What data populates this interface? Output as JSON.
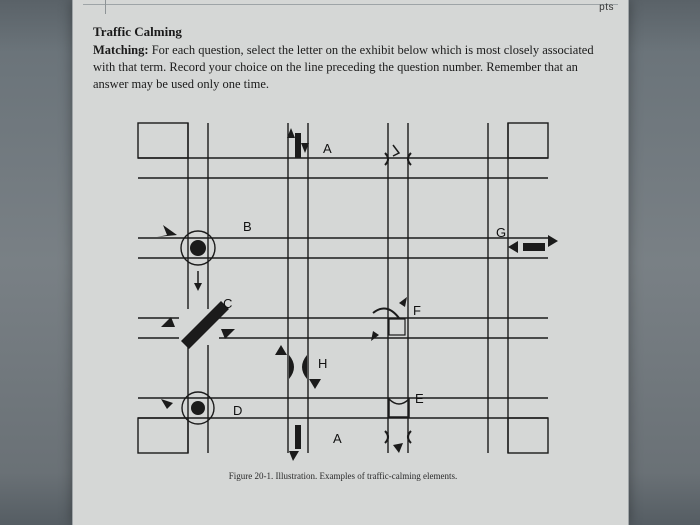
{
  "header_fragment": "pts",
  "title": "Traffic Calming",
  "instructions_lead": "Matching:",
  "instructions_body": "For each question, select the letter on the exhibit below which is most closely associated with that term. Record your choice on the line preceding the question number. Remember that an answer may be used only one time.",
  "labels": {
    "A_top": "A",
    "B": "B",
    "C": "C",
    "D": "D",
    "E": "E",
    "F": "F",
    "G": "G",
    "H": "H",
    "A_bottom": "A"
  },
  "caption": "Figure 20-1. Illustration. Examples of traffic-calming elements."
}
